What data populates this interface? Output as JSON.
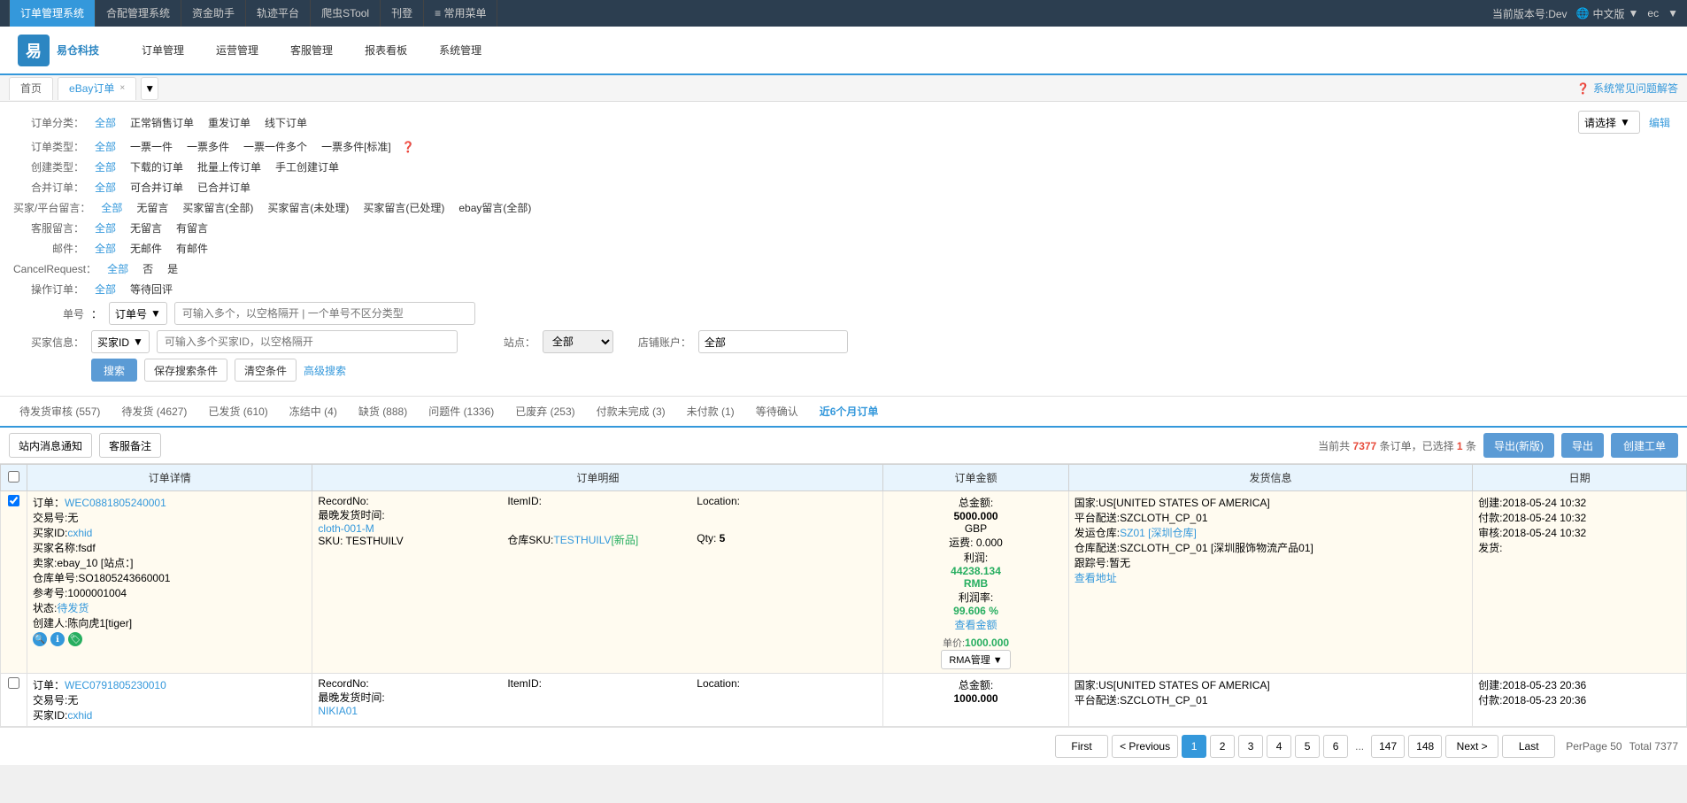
{
  "topNav": {
    "items": [
      {
        "label": "订单管理系统",
        "active": true
      },
      {
        "label": "合配管理系统",
        "active": false
      },
      {
        "label": "资金助手",
        "active": false
      },
      {
        "label": "轨迹平台",
        "active": false
      },
      {
        "label": "爬虫STool",
        "active": false
      },
      {
        "label": "刊登",
        "active": false
      },
      {
        "label": "≡ 常用菜单",
        "active": false
      }
    ],
    "version": "当前版本号:Dev",
    "language": "中文版",
    "user": "ec"
  },
  "header": {
    "logo": "易仓科技",
    "logoShort": "易",
    "menuItems": [
      {
        "label": "订单管理"
      },
      {
        "label": "运营管理"
      },
      {
        "label": "客服管理"
      },
      {
        "label": "报表看板"
      },
      {
        "label": "系统管理"
      }
    ]
  },
  "tabs": {
    "home": "首页",
    "ebay": "eBay订单",
    "closeIcon": "×",
    "helpText": "系统常见问题解答"
  },
  "filters": {
    "orderType": {
      "label": "订单分类：",
      "options": [
        "全部",
        "正常销售订单",
        "重发订单",
        "线下订单"
      ],
      "activeOption": "全部",
      "selectPlaceholder": "请选择",
      "editLabel": "编辑"
    },
    "orderModelType": {
      "label": "订单类型：",
      "options": [
        "全部",
        "一票一件",
        "一票多件",
        "一票一件多个",
        "一票多件[标准]"
      ],
      "activeOption": "全部"
    },
    "createType": {
      "label": "创建类型：",
      "options": [
        "全部",
        "下载的订单",
        "批量上传订单",
        "手工创建订单"
      ],
      "activeOption": "全部"
    },
    "mergeOrder": {
      "label": "合并订单：",
      "options": [
        "全部",
        "可合并订单",
        "已合并订单"
      ],
      "activeOption": "全部"
    },
    "buyerRemark": {
      "label": "买家/平台留言：",
      "options": [
        "全部",
        "无留言",
        "买家留言(全部)",
        "买家留言(未处理)",
        "买家留言(已处理)",
        "ebay留言(全部)"
      ],
      "activeOption": "全部"
    },
    "customerRemark": {
      "label": "客服留言：",
      "options": [
        "全部",
        "无留言",
        "有留言"
      ],
      "activeOption": "全部"
    },
    "attachment": {
      "label": "邮件：",
      "options": [
        "全部",
        "无邮件",
        "有邮件"
      ],
      "activeOption": "全部"
    },
    "cancelRequest": {
      "label": "CancelRequest：",
      "options": [
        "全部",
        "否",
        "是"
      ],
      "activeOption": "全部"
    },
    "actionOrder": {
      "label": "操作订单：",
      "options": [
        "全部",
        "等待回评"
      ],
      "activeOption": "全部"
    }
  },
  "search": {
    "orderNoLabel": "单号",
    "orderNoOptions": [
      "订单号"
    ],
    "orderNoPlaceholder": "可输入多个，以空格隔开 | 一个单号不区分类型",
    "buyerInfoLabel": "买家信息：",
    "buyerInfoOptions": [
      "买家ID"
    ],
    "buyerInfoPlaceholder": "可输入多个买家ID，以空格隔开",
    "stationLabel": "站点：",
    "stationValue": "全部",
    "shopAccountLabel": "店铺账户：",
    "shopAccountValue": "全部",
    "searchBtnLabel": "搜索",
    "saveBtnLabel": "保存搜索条件",
    "clearBtnLabel": "清空条件",
    "advancedLabel": "高级搜索"
  },
  "statusTabs": [
    {
      "label": "待发货审核",
      "count": "557",
      "active": false
    },
    {
      "label": "待发货",
      "count": "4627",
      "active": false
    },
    {
      "label": "已发货",
      "count": "610",
      "active": false
    },
    {
      "label": "冻结中",
      "count": "4",
      "active": false
    },
    {
      "label": "缺货",
      "count": "888",
      "active": false
    },
    {
      "label": "问题件",
      "count": "1336",
      "active": false
    },
    {
      "label": "已废弃",
      "count": "253",
      "active": false
    },
    {
      "label": "付款未完成",
      "count": "3",
      "active": false
    },
    {
      "label": "未付款",
      "count": "1",
      "active": false
    },
    {
      "label": "等待确认",
      "count": "",
      "active": false
    },
    {
      "label": "近6个月订单",
      "count": "",
      "active": true
    }
  ],
  "actionBar": {
    "notifyBtn": "站内消息通知",
    "customerNoteBtn": "客服备注",
    "summaryText": "当前共",
    "totalOrders": "7377",
    "summaryText2": "条订单，已选择",
    "selectedCount": "1",
    "summaryText3": "条",
    "exportNewBtn": "导出(新版)",
    "exportBtn": "导出",
    "createOrderBtn": "创建工单"
  },
  "tableHeaders": [
    {
      "label": "☐",
      "key": "checkbox"
    },
    {
      "label": "订单详情",
      "key": "orderDetail"
    },
    {
      "label": "订单明细",
      "key": "orderItems"
    },
    {
      "label": "订单金额",
      "key": "orderAmount"
    },
    {
      "label": "发货信息",
      "key": "shippingInfo"
    },
    {
      "label": "日期",
      "key": "date"
    }
  ],
  "orders": [
    {
      "id": "WEC0881805240001",
      "transactionId": "无",
      "buyerId": "cxhid",
      "buyerName": "fsdf",
      "seller": "ebay_10",
      "station": "[站点：]",
      "warehouseNo": "SO1805243660001",
      "refNo": "1000001004",
      "status": "待发货",
      "creator": "陈向虎1[tiger]",
      "recordNo": "",
      "latestShipTime": "",
      "itemId": "",
      "location": "",
      "clothLink": "cloth-001-M",
      "sku": "TESTHUILV",
      "skuNew": "[新品]",
      "warehouseSku": "TESTHUILV",
      "qty": "5",
      "totalAmount": "5000.000",
      "currency": "GBP",
      "shipping": "0.000",
      "profit": "44238.134",
      "profitCurrency": "RMB",
      "profitRate": "99.606 %",
      "singlePrice": "1000.000",
      "viewDetails": "查看金额",
      "country": "US[UNITED STATES OF AMERICA]",
      "platform": "SZCLOTH_CP_01",
      "warehouse": "SZ01 [深圳仓库]",
      "warehouseShip": "SZCLOTH_CP_01 [深圳服饰物流产品01]",
      "trackingNo": "暂无",
      "viewAddress": "查看地址",
      "createdDate": "2018-05-24 10:32",
      "paidDate": "2018-05-24 10:32",
      "reviewedDate": "2018-05-24 10:32",
      "shippedDate": "",
      "highlighted": true
    },
    {
      "id": "WEC0791805230010",
      "transactionId": "无",
      "buyerId": "cxhid",
      "buyerName": "",
      "seller": "",
      "station": "",
      "warehouseNo": "",
      "refNo": "",
      "status": "",
      "creator": "",
      "recordNo": "",
      "latestShipTime": "",
      "itemId": "",
      "location": "",
      "clothLink": "NIKIA01",
      "sku": "",
      "skuNew": "",
      "warehouseSku": "",
      "qty": "",
      "totalAmount": "1000.000",
      "currency": "",
      "shipping": "",
      "profit": "",
      "profitCurrency": "",
      "profitRate": "",
      "singlePrice": "",
      "viewDetails": "",
      "country": "US[UNITED STATES OF AMERICA]",
      "platform": "SZCLOTH_CP_01",
      "warehouse": "",
      "warehouseShip": "",
      "trackingNo": "",
      "viewAddress": "",
      "createdDate": "2018-05-23 20:36",
      "paidDate": "2018-05-23 20:36",
      "reviewedDate": "",
      "shippedDate": "",
      "highlighted": false
    }
  ],
  "pagination": {
    "firstLabel": "First",
    "prevLabel": "< Previous",
    "nextLabel": "Next >",
    "lastLabel": "Last",
    "pages": [
      "1",
      "2",
      "3",
      "4",
      "5",
      "6",
      "...",
      "147",
      "148"
    ],
    "activePage": "1",
    "perPageLabel": "PerPage",
    "perPageValue": "50",
    "totalLabel": "Total",
    "totalValue": "7377"
  }
}
